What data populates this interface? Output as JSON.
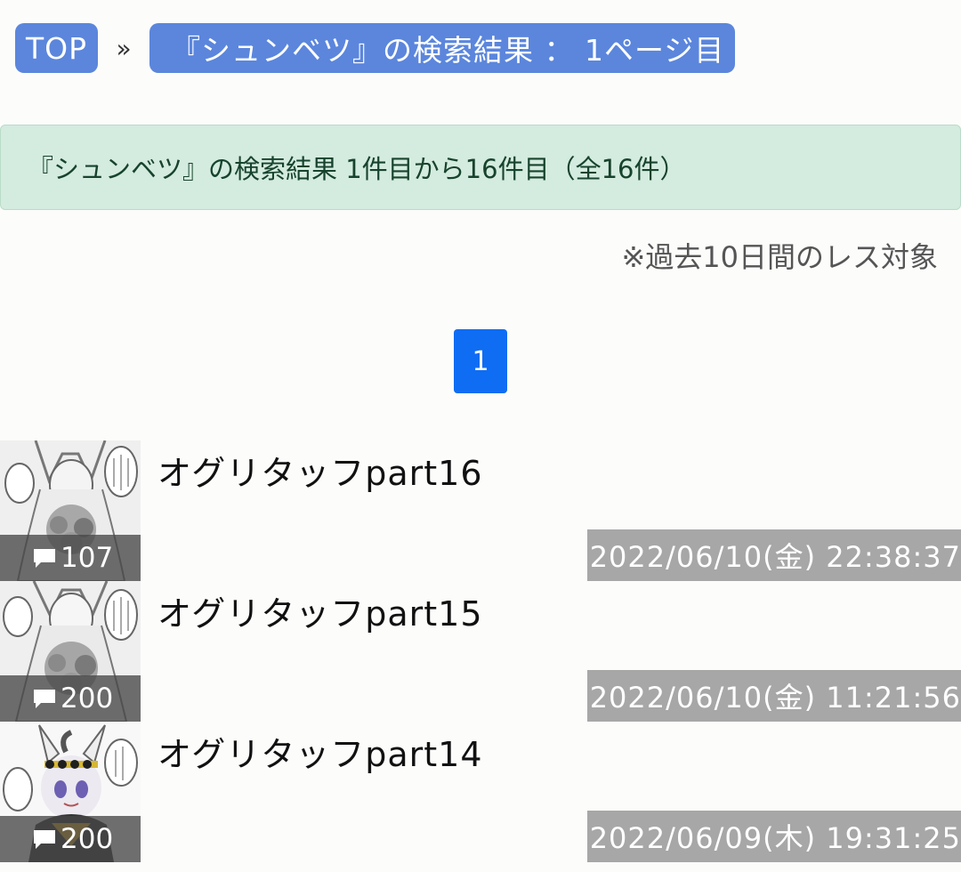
{
  "breadcrumb": {
    "top_label": "TOP",
    "separator": "»",
    "current_label": "『シュンベツ』の検索結果 ： 1ページ目"
  },
  "alert": {
    "text": "『シュンベツ』の検索結果 1件目から16件目（全16件）"
  },
  "note": "※過去10日間のレス対象",
  "pagination": {
    "current_page": "1"
  },
  "threads": [
    {
      "title": "オグリタッフpart16",
      "count": "107",
      "date": "2022/06/10(金) 22:38:37"
    },
    {
      "title": "オグリタッフpart15",
      "count": "200",
      "date": "2022/06/10(金) 11:21:56"
    },
    {
      "title": "オグリタッフpart14",
      "count": "200",
      "date": "2022/06/09(木) 19:31:25"
    }
  ],
  "colors": {
    "breadcrumb_bg": "#5b86dc",
    "alert_bg": "#d4ebdf",
    "pager_bg": "#0f6df3",
    "date_bg": "#a7a7a7"
  },
  "icons": {
    "count": "comment-bubble-icon"
  }
}
